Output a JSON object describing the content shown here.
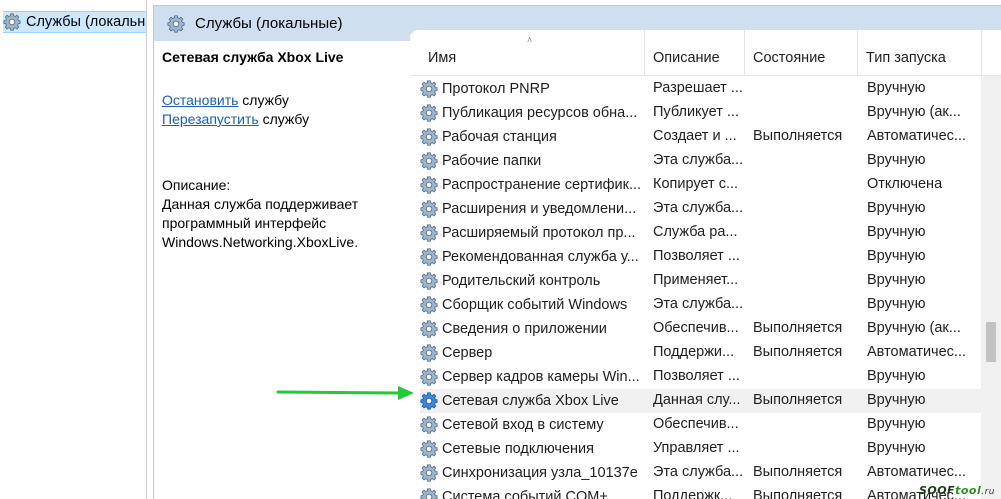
{
  "tree": {
    "label": "Службы (локальн",
    "icon": "services-gear-icon"
  },
  "header": {
    "title": "Службы (локальные)",
    "icon": "services-gear-icon"
  },
  "details": {
    "title": "Сетевая служба Xbox Live",
    "stop_link": "Остановить",
    "stop_suffix": " службу",
    "restart_link": "Перезапустить",
    "restart_suffix": " службу",
    "desc_heading": "Описание:",
    "desc_text": "Данная служба поддерживает программный интерфейс Windows.Networking.XboxLive."
  },
  "columns": {
    "name": "Имя",
    "description": "Описание",
    "state": "Состояние",
    "startup_type": "Тип запуска"
  },
  "rows": [
    {
      "name": "Протокол PNRP",
      "description": "Разрешает ...",
      "state": "",
      "startup_type": "Вручную"
    },
    {
      "name": "Публикация ресурсов обна...",
      "description": "Публикует ...",
      "state": "",
      "startup_type": "Вручную (ак..."
    },
    {
      "name": "Рабочая станция",
      "description": "Создает и ...",
      "state": "Выполняется",
      "startup_type": "Автоматичес..."
    },
    {
      "name": "Рабочие папки",
      "description": "Эта служба...",
      "state": "",
      "startup_type": "Вручную"
    },
    {
      "name": "Распространение сертифик...",
      "description": "Копирует с...",
      "state": "",
      "startup_type": "Отключена"
    },
    {
      "name": "Расширения и уведомлени...",
      "description": "Эта служба...",
      "state": "",
      "startup_type": "Вручную"
    },
    {
      "name": "Расширяемый протокол пр...",
      "description": "Служба ра...",
      "state": "",
      "startup_type": "Вручную"
    },
    {
      "name": "Рекомендованная служба у...",
      "description": "Позволяет ...",
      "state": "",
      "startup_type": "Вручную"
    },
    {
      "name": "Родительский контроль",
      "description": "Применяет...",
      "state": "",
      "startup_type": "Вручную"
    },
    {
      "name": "Сборщик событий Windows",
      "description": "Эта служба...",
      "state": "",
      "startup_type": "Вручную"
    },
    {
      "name": "Сведения о приложении",
      "description": "Обеспечив...",
      "state": "Выполняется",
      "startup_type": "Вручную (ак..."
    },
    {
      "name": "Сервер",
      "description": "Поддержи...",
      "state": "Выполняется",
      "startup_type": "Автоматичес..."
    },
    {
      "name": "Сервер кадров камеры Win...",
      "description": "Позволяет ...",
      "state": "",
      "startup_type": "Вручную"
    },
    {
      "name": "Сетевая служба Xbox Live",
      "description": "Данная слу...",
      "state": "Выполняется",
      "startup_type": "Вручную",
      "selected": true
    },
    {
      "name": "Сетевой вход в систему",
      "description": "Обеспечив...",
      "state": "",
      "startup_type": "Вручную"
    },
    {
      "name": "Сетевые подключения",
      "description": "Управляет ...",
      "state": "",
      "startup_type": "Вручную"
    },
    {
      "name": "Синхронизация узла_10137e",
      "description": "Эта служба...",
      "state": "Выполняется",
      "startup_type": "Автоматичес..."
    },
    {
      "name": "Система событий COM+",
      "description": "Поддержк...",
      "state": "Выполняется",
      "startup_type": "Автоматичес..."
    }
  ],
  "watermark": {
    "part1": "SOOF",
    "part2": "tool",
    "part3": ".ru"
  },
  "colors": {
    "header_bg": "#cfdff0",
    "link": "#1a5fb4",
    "arrow": "#22c93a",
    "selected_row": "#f0f0f0"
  }
}
